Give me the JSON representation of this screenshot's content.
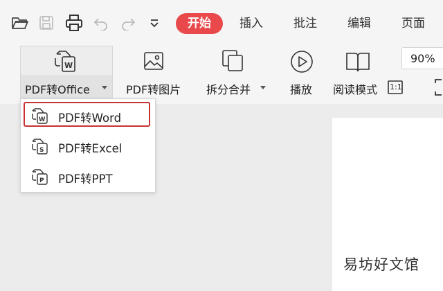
{
  "toolbar": {
    "tabs": [
      "开始",
      "插入",
      "批注",
      "编辑",
      "页面"
    ],
    "icons": [
      "folder-open-icon",
      "save-icon",
      "print-icon",
      "undo-icon",
      "redo-icon",
      "chevron-down-icon"
    ]
  },
  "ribbon": {
    "pdf_to_office": "PDF转Office",
    "pdf_to_image": "PDF转图片",
    "split_merge": "拆分合并",
    "play": "播放",
    "read_mode": "阅读模式",
    "zoom": "90%",
    "actual_size": "1:1"
  },
  "menu": {
    "items": [
      {
        "label": "PDF转Word",
        "icon": "word-doc-icon",
        "highlighted": true
      },
      {
        "label": "PDF转Excel",
        "icon": "excel-doc-icon",
        "highlighted": false
      },
      {
        "label": "PDF转PPT",
        "icon": "ppt-doc-icon",
        "highlighted": false
      }
    ]
  },
  "watermark": "易坊好文馆",
  "colors": {
    "accent": "#e9494b",
    "highlight_border": "#c83232",
    "background": "#ececec",
    "toolbar_bg": "#f5f5f5"
  }
}
